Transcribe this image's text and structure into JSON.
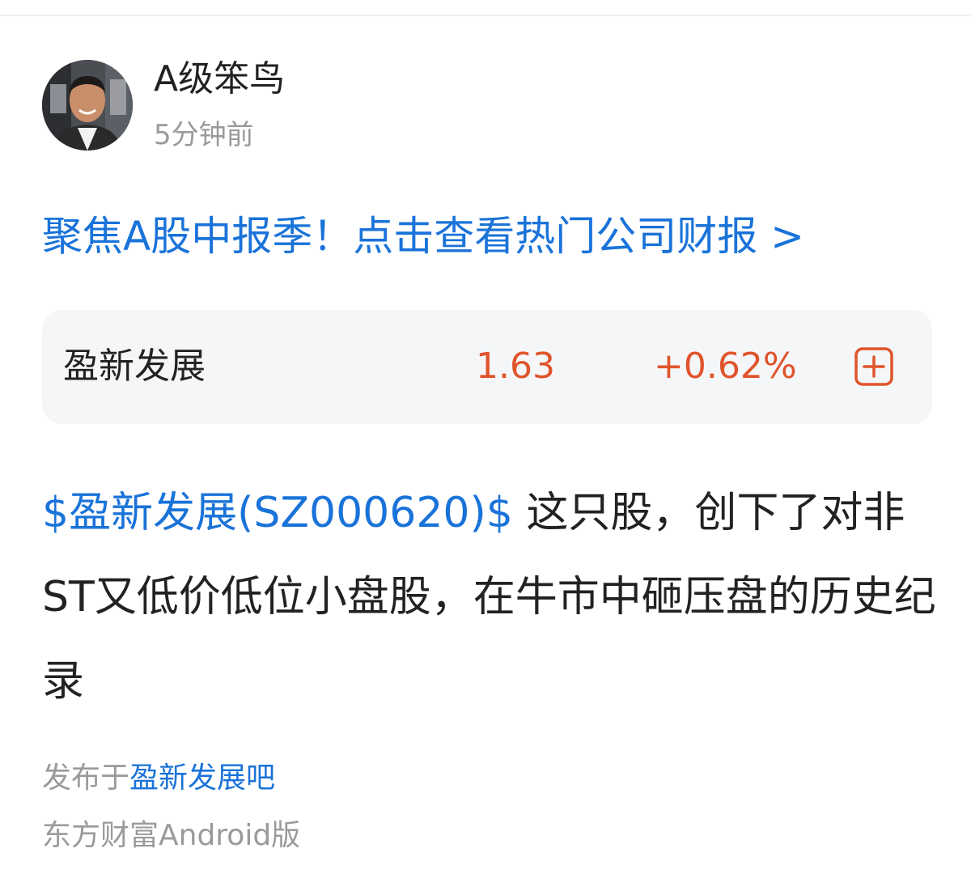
{
  "post": {
    "author": {
      "username": "A级笨鸟",
      "time_ago": "5分钟前"
    },
    "promo_banner": "聚焦A股中报季！点击查看热门公司财报 >",
    "stock_card": {
      "name": "盈新发展",
      "price": "1.63",
      "change": "+0.62%",
      "add_icon": "plus-square-icon"
    },
    "content": {
      "stock_tag": "$盈新发展(SZ000620)$",
      "text": " 这只股，创下了对非ST又低价低位小盘股，在牛市中砸压盘的历史纪录"
    },
    "published_prefix": "发布于",
    "forum_name": "盈新发展吧",
    "source": "东方财富Android版"
  },
  "colors": {
    "link_blue": "#1a73d9",
    "price_up": "#e0542b",
    "text_primary": "#222222",
    "text_secondary": "#9a9a9a",
    "card_bg": "#f5f6f8"
  }
}
